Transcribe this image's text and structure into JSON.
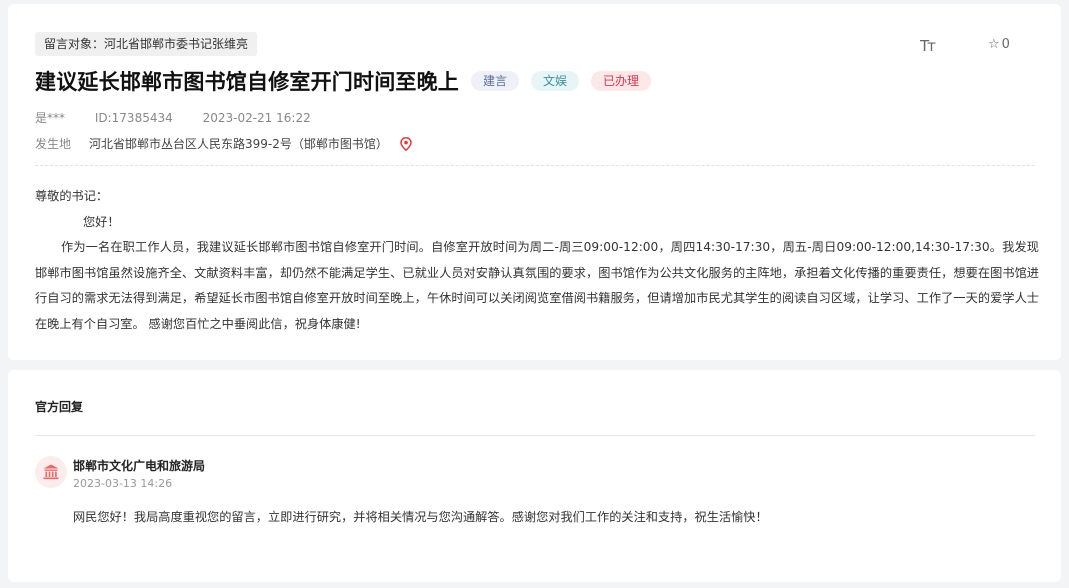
{
  "message": {
    "target_tag": "留言对象：河北省邯郸市委书记张维亮",
    "font_size_label": "Tт",
    "favorite_count": "0",
    "title": "建议延长邯郸市图书馆自修室开门时间至晚上",
    "badges": [
      "建言",
      "文娱",
      "已办理"
    ],
    "author": "是***",
    "id": "ID:17385434",
    "date": "2023-02-21 16:22",
    "location_label": "发生地",
    "location": "河北省邯郸市丛台区人民东路399-2号（邯郸市图书馆）",
    "salutation": "尊敬的书记：",
    "greeting": "您好！",
    "content": "作为一名在职工作人员，我建议延长邯郸市图书馆自修室开门时间。自修室开放时间为周二-周三09:00-12:00，周四14:30-17:30，周五-周日09:00-12:00,14:30-17:30。我发现邯郸市图书馆虽然设施齐全、文献资料丰富，却仍然不能满足学生、已就业人员对安静认真氛围的要求，图书馆作为公共文化服务的主阵地，承担着文化传播的重要责任，想要在图书馆进行自习的需求无法得到满足，希望延长市图书馆自修室开放时间至晚上，午休时间可以关闭阅览室借阅书籍服务，但请增加市民尤其学生的阅读自习区域，让学习、工作了一天的爱学人士在晚上有个自习室。 感谢您百忙之中垂阅此信，祝身体康健!"
  },
  "reply": {
    "heading": "官方回复",
    "department": "邯郸市文化广电和旅游局",
    "time": "2023-03-13 14:26",
    "content": "网民您好！我局高度重视您的留言，立即进行研究，并将相关情况与您沟通解答。感谢您对我们工作的关注和支持，祝生活愉快！"
  },
  "icons": {
    "font_size": "font-size-icon",
    "favorite": "star-icon",
    "location": "location-pin-icon",
    "department": "bank-building-icon"
  },
  "colors": {
    "badge_blue_text": "#5a6f96",
    "badge_teal_text": "#3f8f9e",
    "badge_red_text": "#d9364a",
    "pin": "#e03a3a"
  }
}
